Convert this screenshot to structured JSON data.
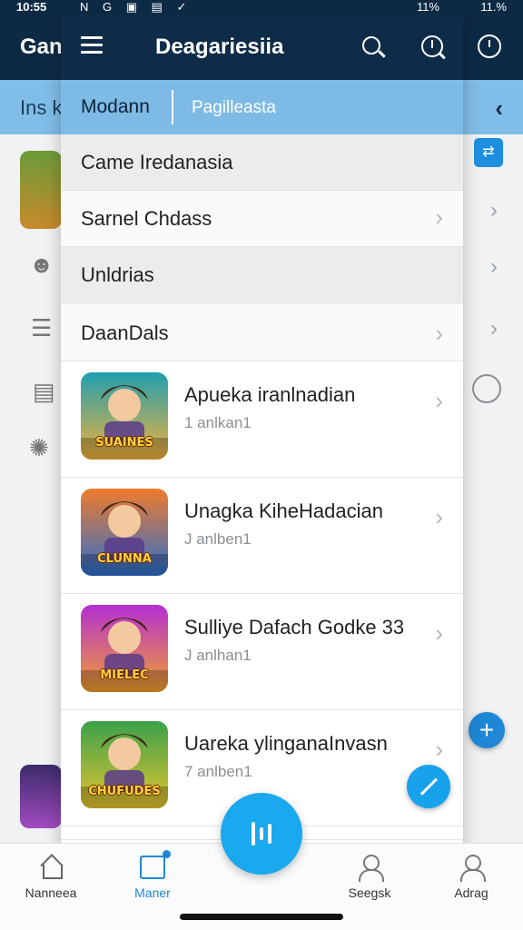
{
  "status_bar": {
    "time": "10:55",
    "icons": "N G ▣ ▤ ✓",
    "battery_left": "11%",
    "battery_right": "11.%"
  },
  "background_app": {
    "title": "Gan",
    "tab_text": "Ins k"
  },
  "panel": {
    "title": "Deagariesiia",
    "tabs": [
      "Modann",
      "Pagilleasta"
    ],
    "menu_items": [
      {
        "label": "Came Iredanasia"
      },
      {
        "label": "Sarnel Chdass"
      },
      {
        "label": "Unldrias"
      },
      {
        "label": "DaanDals"
      }
    ],
    "games": [
      {
        "name": "Apueka iranlnadian",
        "sub": "1 anlkan1",
        "icon_text": "SUAINES",
        "colors": [
          "#1f9fb0",
          "#f4b23a"
        ]
      },
      {
        "name": "Unagka KiheHadacian",
        "sub": "J anlben1",
        "icon_text": "CLUNNA",
        "colors": [
          "#f07b2b",
          "#2b6fd0"
        ]
      },
      {
        "name": "Sulliye Dafach Godke 33",
        "sub": "J anlhan1",
        "icon_text": "MIELEC",
        "colors": [
          "#b52fd3",
          "#f2a12d"
        ]
      },
      {
        "name": "Uareka ylinganaInvasn",
        "sub": "7 anlben1",
        "icon_text": "CHUFUDES",
        "colors": [
          "#3aa14a",
          "#e7c52f"
        ]
      }
    ]
  },
  "bottom_nav": [
    {
      "label": "Nanneea",
      "icon": "home-icon"
    },
    {
      "label": "Maner",
      "icon": "store-icon"
    },
    {
      "label": "Seegsk",
      "icon": "person-icon"
    },
    {
      "label": "Adrag",
      "icon": "person-icon"
    }
  ]
}
